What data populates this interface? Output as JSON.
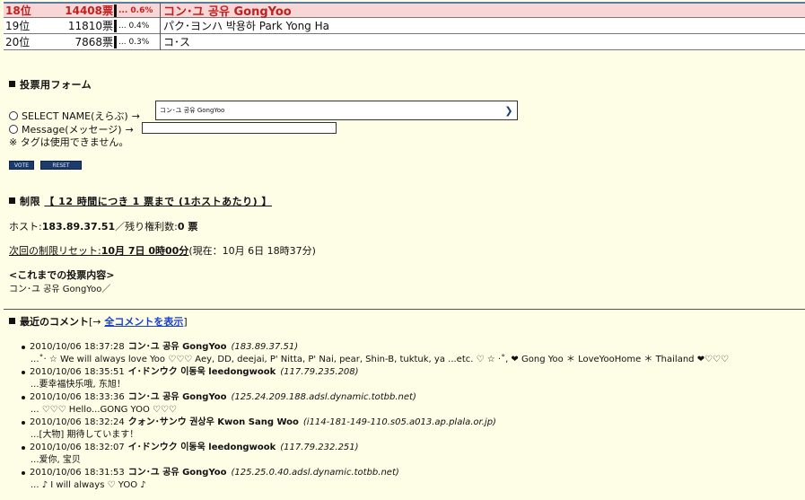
{
  "ranking": [
    {
      "rank": "18位",
      "votes": "14408票",
      "pct": "... 0.6%",
      "name": "コン･ユ 공유 GongYoo",
      "highlight": true
    },
    {
      "rank": "19位",
      "votes": "11810票",
      "pct": "... 0.4%",
      "name": "パク･ヨンハ 박용하 Park Yong Ha",
      "highlight": false
    },
    {
      "rank": "20位",
      "votes": "7868票",
      "pct": "... 0.3%",
      "name": "コ･ス",
      "highlight": false
    }
  ],
  "form": {
    "title": "投票用フォーム",
    "select_label": "SELECT NAME(えらぶ)",
    "select_value": "コン･ユ 공유 GongYoo",
    "message_label": "Message(メッセージ)",
    "arrow": "→",
    "note": "※ タグは使用できません。",
    "vote_button": "VOTE",
    "reset_button": "RESET"
  },
  "limit": {
    "title_prefix": "制限",
    "title_link": "【 12 時間につき 1 票まで (1ホストあたり) 】",
    "host_label": "ホスト:",
    "host_value": "183.89.37.51",
    "remaining_label": "／残り権利数:",
    "remaining_value": "0 票",
    "reset_label": "次回の制限リセット:",
    "reset_value": "10月 7日 0時00分",
    "now_text": "(現在：10月 6日 18時37分)"
  },
  "history": {
    "title": "<これまでの投票内容>",
    "value": "コン･ユ 공유 GongYoo／"
  },
  "comments_section": {
    "title": "最近のコメント",
    "bracket_open": "[→",
    "link": "全コメントを表示",
    "bracket_close": "]",
    "items": [
      {
        "date": "2010/10/06 18:37:28",
        "user": "コン･ユ 공유 GongYoo",
        "host": "(183.89.37.51)",
        "body": "...˚‧ ☆ We will always love Yoo ♡♡♡ Aey, DD, deejai, P' Nitta, P' Nai, pear, Shin-B, tuktuk, ya ...etc. ♡ ☆ ‧˚, ❤ Gong Yoo ＊ LoveYooHome ＊ Thailand ❤♡♡♡"
      },
      {
        "date": "2010/10/06 18:35:51",
        "user": "イ･ドンウク 이동욱 leedongwook",
        "host": "(117.79.235.208)",
        "body": "...要幸福快乐哦, 东旭！"
      },
      {
        "date": "2010/10/06 18:33:36",
        "user": "コン･ユ 공유 GongYoo",
        "host": "(125.24.209.188.adsl.dynamic.totbb.net)",
        "body": "... ♡♡♡ Hello...GONG YOO ♡♡♡"
      },
      {
        "date": "2010/10/06 18:32:24",
        "user": "クォン･サンウ 권상우 Kwon Sang Woo",
        "host": "(i114-181-149-110.s05.a013.ap.plala.or.jp)",
        "body": "...[大物] 期待しています！"
      },
      {
        "date": "2010/10/06 18:32:07",
        "user": "イ･ドンウク 이동욱 leedongwook",
        "host": "(117.79.232.251)",
        "body": "...爱你, 宝贝"
      },
      {
        "date": "2010/10/06 18:31:53",
        "user": "コン･ユ 공유 GongYoo",
        "host": "(125.25.0.40.adsl.dynamic.totbb.net)",
        "body": "... ♪ I will always ♡ YOO ♪"
      }
    ]
  }
}
